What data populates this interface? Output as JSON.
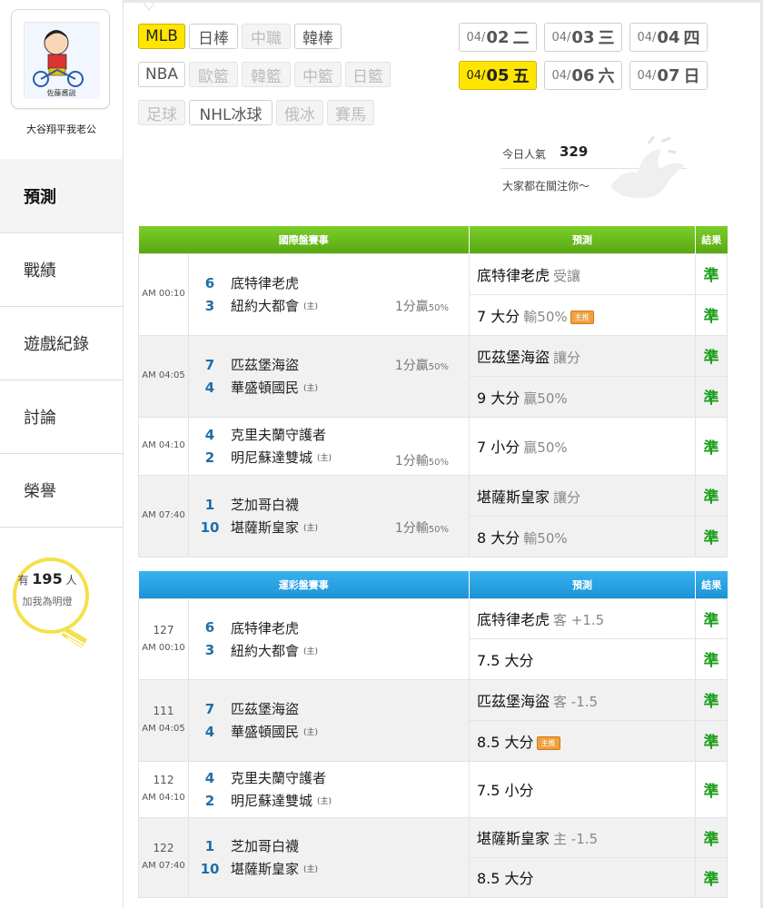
{
  "profile": {
    "avatar_caption": "佐藤酱説",
    "username": "大谷翔平我老公"
  },
  "nav": [
    {
      "label": "預測",
      "active": true
    },
    {
      "label": "戰績"
    },
    {
      "label": "遊戲紀錄"
    },
    {
      "label": "討論"
    },
    {
      "label": "榮譽"
    }
  ],
  "fans": {
    "prefix": "有",
    "count": "195",
    "suffix": "人",
    "line2": "加我為明燈"
  },
  "sports": [
    {
      "label": "MLB",
      "state": "active"
    },
    {
      "label": "日棒",
      "state": "normal"
    },
    {
      "label": "中職",
      "state": "disabled"
    },
    {
      "label": "韓棒",
      "state": "normal"
    },
    {
      "label": "NBA",
      "state": "normal"
    },
    {
      "label": "歐籃",
      "state": "disabled"
    },
    {
      "label": "韓籃",
      "state": "disabled"
    },
    {
      "label": "中籃",
      "state": "disabled"
    },
    {
      "label": "日籃",
      "state": "disabled"
    },
    {
      "label": "足球",
      "state": "disabled"
    },
    {
      "label": "NHL冰球",
      "state": "normal"
    },
    {
      "label": "俄冰",
      "state": "disabled"
    },
    {
      "label": "賽馬",
      "state": "disabled"
    }
  ],
  "dates": [
    {
      "md": "04/",
      "dd": "02",
      "wd": "二"
    },
    {
      "md": "04/",
      "dd": "03",
      "wd": "三"
    },
    {
      "md": "04/",
      "dd": "04",
      "wd": "四"
    },
    {
      "md": "04/",
      "dd": "05",
      "wd": "五",
      "active": true
    },
    {
      "md": "04/",
      "dd": "06",
      "wd": "六"
    },
    {
      "md": "04/",
      "dd": "07",
      "wd": "日"
    }
  ],
  "popularity": {
    "label": "今日人氣",
    "count": "329",
    "sub": "大家都在關注你～"
  },
  "intl": {
    "header": {
      "events": "國際盤賽事",
      "predict": "預測",
      "result": "結果"
    },
    "games": [
      {
        "time": "AM 00:10",
        "away_score": "6",
        "away": "底特律老虎",
        "home_score": "3",
        "home": "紐約大都會",
        "home_mark": "(主)",
        "odds": "1分贏",
        "odds_pct": "50%",
        "odds_row": "home",
        "preds": [
          {
            "main": "底特律老虎",
            "sub": "受讓",
            "result": "準"
          },
          {
            "main": "7 大分",
            "sub": "輸50%",
            "badge": "主推",
            "result": "準"
          }
        ]
      },
      {
        "time": "AM 04:05",
        "away_score": "7",
        "away": "匹茲堡海盜",
        "home_score": "4",
        "home": "華盛頓國民",
        "home_mark": "(主)",
        "odds": "1分贏",
        "odds_pct": "50%",
        "odds_row": "away",
        "preds": [
          {
            "main": "匹茲堡海盜",
            "sub": "讓分",
            "result": "準"
          },
          {
            "main": "9 大分",
            "sub": "贏50%",
            "result": "準"
          }
        ]
      },
      {
        "time": "AM 04:10",
        "away_score": "4",
        "away": "克里夫蘭守護者",
        "home_score": "2",
        "home": "明尼蘇達雙城",
        "home_mark": "(主)",
        "odds": "1分輸",
        "odds_pct": "50%",
        "odds_row": "home",
        "preds": [
          {
            "main": "7 小分",
            "sub": "贏50%",
            "result": "準"
          }
        ]
      },
      {
        "time": "AM 07:40",
        "away_score": "1",
        "away": "芝加哥白襪",
        "home_score": "10",
        "home": "堪薩斯皇家",
        "home_mark": "(主)",
        "odds": "1分輸",
        "odds_pct": "50%",
        "odds_row": "home",
        "preds": [
          {
            "main": "堪薩斯皇家",
            "sub": "讓分",
            "result": "準"
          },
          {
            "main": "8 大分",
            "sub": "輸50%",
            "result": "準"
          }
        ]
      }
    ]
  },
  "lottery": {
    "header": {
      "events": "運彩盤賽事",
      "predict": "預測",
      "result": "結果"
    },
    "games": [
      {
        "num": "127",
        "time": "AM 00:10",
        "away_score": "6",
        "away": "底特律老虎",
        "home_score": "3",
        "home": "紐約大都會",
        "home_mark": "(主)",
        "preds": [
          {
            "main": "底特律老虎",
            "sub": "客 +1.5",
            "result": "準"
          },
          {
            "main": "7.5 大分",
            "sub": "",
            "result": "準"
          }
        ]
      },
      {
        "num": "111",
        "time": "AM 04:05",
        "away_score": "7",
        "away": "匹茲堡海盜",
        "home_score": "4",
        "home": "華盛頓國民",
        "home_mark": "(主)",
        "preds": [
          {
            "main": "匹茲堡海盜",
            "sub": "客 -1.5",
            "result": "準"
          },
          {
            "main": "8.5 大分",
            "sub": "",
            "badge": "主推",
            "result": "準"
          }
        ]
      },
      {
        "num": "112",
        "time": "AM 04:10",
        "away_score": "4",
        "away": "克里夫蘭守護者",
        "home_score": "2",
        "home": "明尼蘇達雙城",
        "home_mark": "(主)",
        "preds": [
          {
            "main": "7.5 小分",
            "sub": "",
            "result": "準"
          }
        ]
      },
      {
        "num": "122",
        "time": "AM 07:40",
        "away_score": "1",
        "away": "芝加哥白襪",
        "home_score": "10",
        "home": "堪薩斯皇家",
        "home_mark": "(主)",
        "preds": [
          {
            "main": "堪薩斯皇家",
            "sub": "主 -1.5",
            "result": "準"
          },
          {
            "main": "8.5 大分",
            "sub": "",
            "result": "準"
          }
        ]
      }
    ]
  },
  "colors": {
    "accent_yellow": "#ffe500",
    "green_header": "#62b31a",
    "blue_header": "#25a0e0",
    "result_green": "#1a9e1a",
    "score_blue": "#1f6ea8"
  }
}
